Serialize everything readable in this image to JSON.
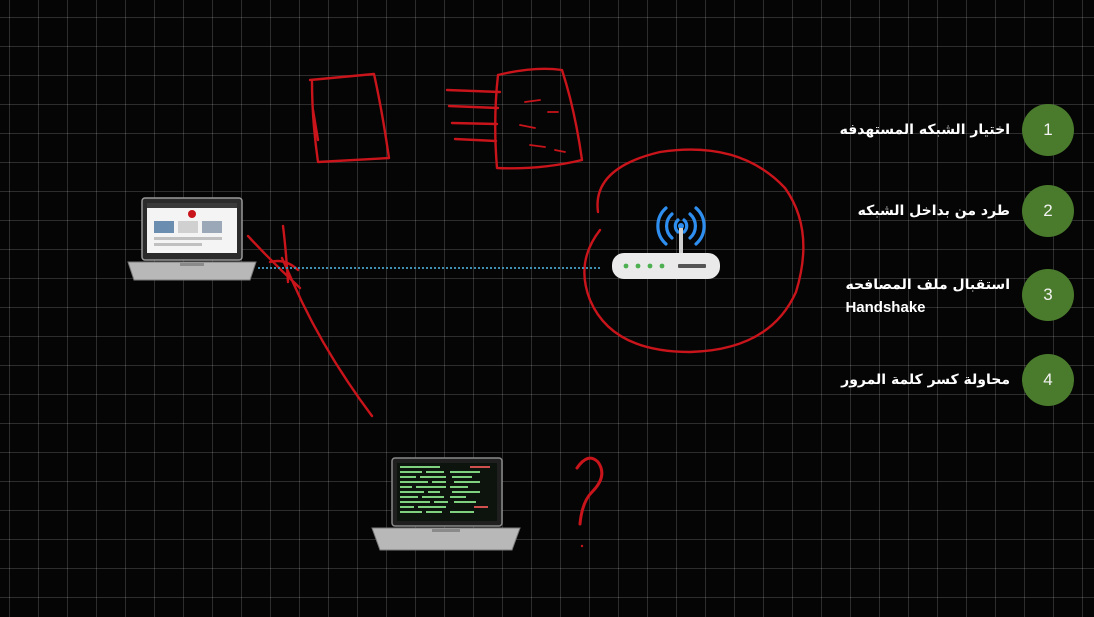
{
  "colors": {
    "background": "#050505",
    "grid": "#2b2b2b",
    "step_circle": "#4a7b2c",
    "ink": "#c8141a",
    "wifi": "#2f8ff0",
    "link": "#3f8fb0"
  },
  "icons": {
    "victim_laptop": "laptop-browser-icon",
    "attacker_laptop": "laptop-terminal-icon",
    "router": "wifi-router-icon"
  },
  "steps": [
    {
      "number": "1",
      "text": "اختيار الشبكه المستهدفه"
    },
    {
      "number": "2",
      "text": "طرد من بداخل الشبكه"
    },
    {
      "number": "3",
      "text": "استقبال ملف المصافحه",
      "text_extra": "Handshake"
    },
    {
      "number": "4",
      "text": "محاولة كسر كلمة المرور"
    }
  ],
  "annotations": {
    "question_mark": "?"
  }
}
